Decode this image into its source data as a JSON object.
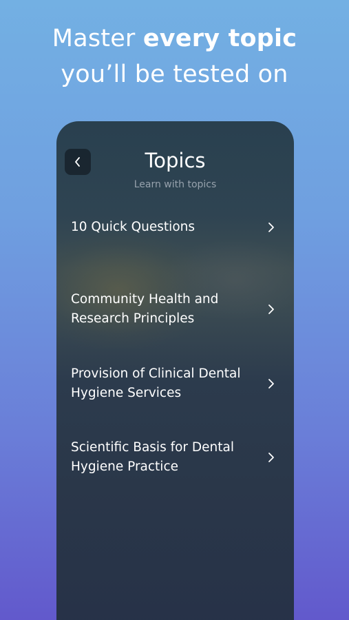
{
  "headline": {
    "line1_normal": "Master ",
    "line1_bold": "every topic",
    "line2": "you’ll be tested on"
  },
  "screen": {
    "title": "Topics",
    "subtitle": "Learn with topics",
    "back_icon": "chevron-left-icon",
    "topics": [
      {
        "label": "10 Quick Questions"
      },
      {
        "label": "Community Health and Research Principles"
      },
      {
        "label": "Provision of Clinical Dental Hygiene Services"
      },
      {
        "label": "Scientific Basis for Dental Hygiene Practice"
      }
    ],
    "row_icon": "chevron-right-icon"
  },
  "colors": {
    "background_top": "#73b0e3",
    "background_bottom": "#6259cc",
    "text_primary": "#ffffff",
    "text_secondary": "#97a2ad"
  }
}
